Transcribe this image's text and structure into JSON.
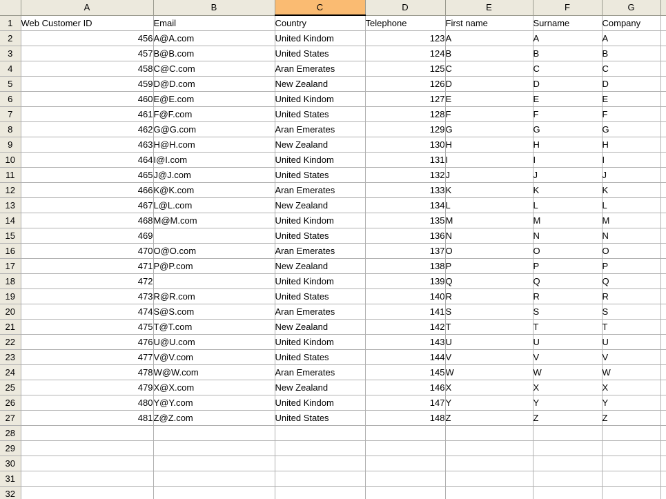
{
  "spreadsheet": {
    "corner_label": "",
    "selected_column": "C",
    "column_headers": [
      "A",
      "B",
      "C",
      "D",
      "E",
      "F",
      "G"
    ],
    "column_header_names": {
      "a": "A",
      "b": "B",
      "c": "C",
      "d": "D",
      "e": "E",
      "f": "F",
      "g": "G"
    },
    "header_row_number": "1",
    "headers": {
      "web_customer_id": "Web Customer ID",
      "email": "Email",
      "country": "Country",
      "telephone": "Telephone",
      "first_name": "First name",
      "surname": "Surname",
      "company": "Company"
    },
    "rows": [
      {
        "n": "2",
        "id": "456",
        "email": "A@A.com",
        "country": "United Kindom",
        "tel": "123",
        "first": "A",
        "surname": "A",
        "company": "A"
      },
      {
        "n": "3",
        "id": "457",
        "email": "B@B.com",
        "country": "United States",
        "tel": "124",
        "first": "B",
        "surname": "B",
        "company": "B"
      },
      {
        "n": "4",
        "id": "458",
        "email": "C@C.com",
        "country": "Aran Emerates",
        "tel": "125",
        "first": "C",
        "surname": "C",
        "company": "C"
      },
      {
        "n": "5",
        "id": "459",
        "email": "D@D.com",
        "country": "New Zealand",
        "tel": "126",
        "first": "D",
        "surname": "D",
        "company": "D"
      },
      {
        "n": "6",
        "id": "460",
        "email": "E@E.com",
        "country": "United Kindom",
        "tel": "127",
        "first": "E",
        "surname": "E",
        "company": "E"
      },
      {
        "n": "7",
        "id": "461",
        "email": "F@F.com",
        "country": "United States",
        "tel": "128",
        "first": "F",
        "surname": "F",
        "company": "F"
      },
      {
        "n": "8",
        "id": "462",
        "email": "G@G.com",
        "country": "Aran Emerates",
        "tel": "129",
        "first": "G",
        "surname": "G",
        "company": "G"
      },
      {
        "n": "9",
        "id": "463",
        "email": "H@H.com",
        "country": "New Zealand",
        "tel": "130",
        "first": "H",
        "surname": "H",
        "company": "H"
      },
      {
        "n": "10",
        "id": "464",
        "email": "I@I.com",
        "country": "United Kindom",
        "tel": "131",
        "first": "I",
        "surname": "I",
        "company": "I"
      },
      {
        "n": "11",
        "id": "465",
        "email": "J@J.com",
        "country": "United States",
        "tel": "132",
        "first": "J",
        "surname": "J",
        "company": "J"
      },
      {
        "n": "12",
        "id": "466",
        "email": "K@K.com",
        "country": "Aran Emerates",
        "tel": "133",
        "first": "K",
        "surname": "K",
        "company": "K"
      },
      {
        "n": "13",
        "id": "467",
        "email": "L@L.com",
        "country": "New Zealand",
        "tel": "134",
        "first": "L",
        "surname": "L",
        "company": "L"
      },
      {
        "n": "14",
        "id": "468",
        "email": "M@M.com",
        "country": "United Kindom",
        "tel": "135",
        "first": "M",
        "surname": "M",
        "company": "M"
      },
      {
        "n": "15",
        "id": "469",
        "email": "",
        "country": "United States",
        "tel": "136",
        "first": "N",
        "surname": "N",
        "company": "N"
      },
      {
        "n": "16",
        "id": "470",
        "email": "O@O.com",
        "country": "Aran Emerates",
        "tel": "137",
        "first": "O",
        "surname": "O",
        "company": "O"
      },
      {
        "n": "17",
        "id": "471",
        "email": "P@P.com",
        "country": "New Zealand",
        "tel": "138",
        "first": "P",
        "surname": "P",
        "company": "P"
      },
      {
        "n": "18",
        "id": "472",
        "email": "",
        "country": "United Kindom",
        "tel": "139",
        "first": "Q",
        "surname": "Q",
        "company": "Q"
      },
      {
        "n": "19",
        "id": "473",
        "email": "R@R.com",
        "country": "United States",
        "tel": "140",
        "first": "R",
        "surname": "R",
        "company": "R"
      },
      {
        "n": "20",
        "id": "474",
        "email": "S@S.com",
        "country": "Aran Emerates",
        "tel": "141",
        "first": "S",
        "surname": "S",
        "company": "S"
      },
      {
        "n": "21",
        "id": "475",
        "email": "T@T.com",
        "country": "New Zealand",
        "tel": "142",
        "first": "T",
        "surname": "T",
        "company": "T"
      },
      {
        "n": "22",
        "id": "476",
        "email": "U@U.com",
        "country": "United Kindom",
        "tel": "143",
        "first": "U",
        "surname": "U",
        "company": "U"
      },
      {
        "n": "23",
        "id": "477",
        "email": "V@V.com",
        "country": "United States",
        "tel": "144",
        "first": "V",
        "surname": "V",
        "company": "V"
      },
      {
        "n": "24",
        "id": "478",
        "email": "W@W.com",
        "country": "Aran Emerates",
        "tel": "145",
        "first": "W",
        "surname": "W",
        "company": "W"
      },
      {
        "n": "25",
        "id": "479",
        "email": "X@X.com",
        "country": "New Zealand",
        "tel": "146",
        "first": "X",
        "surname": "X",
        "company": "X"
      },
      {
        "n": "26",
        "id": "480",
        "email": "Y@Y.com",
        "country": "United Kindom",
        "tel": "147",
        "first": "Y",
        "surname": "Y",
        "company": "Y"
      },
      {
        "n": "27",
        "id": "481",
        "email": "Z@Z.com",
        "country": "United States",
        "tel": "148",
        "first": "Z",
        "surname": "Z",
        "company": "Z"
      },
      {
        "n": "28",
        "id": "",
        "email": "",
        "country": "",
        "tel": "",
        "first": "",
        "surname": "",
        "company": ""
      },
      {
        "n": "29",
        "id": "",
        "email": "",
        "country": "",
        "tel": "",
        "first": "",
        "surname": "",
        "company": ""
      },
      {
        "n": "30",
        "id": "",
        "email": "",
        "country": "",
        "tel": "",
        "first": "",
        "surname": "",
        "company": ""
      },
      {
        "n": "31",
        "id": "",
        "email": "",
        "country": "",
        "tel": "",
        "first": "",
        "surname": "",
        "company": ""
      },
      {
        "n": "32",
        "id": "",
        "email": "",
        "country": "",
        "tel": "",
        "first": "",
        "surname": "",
        "company": ""
      }
    ],
    "colors": {
      "header_background": "#ece9dd",
      "selected_header_background": "#fabb72",
      "gridline": "#b0b0b0",
      "header_border": "#9a9a8e",
      "cell_background": "#ffffff",
      "text": "#000000"
    }
  }
}
